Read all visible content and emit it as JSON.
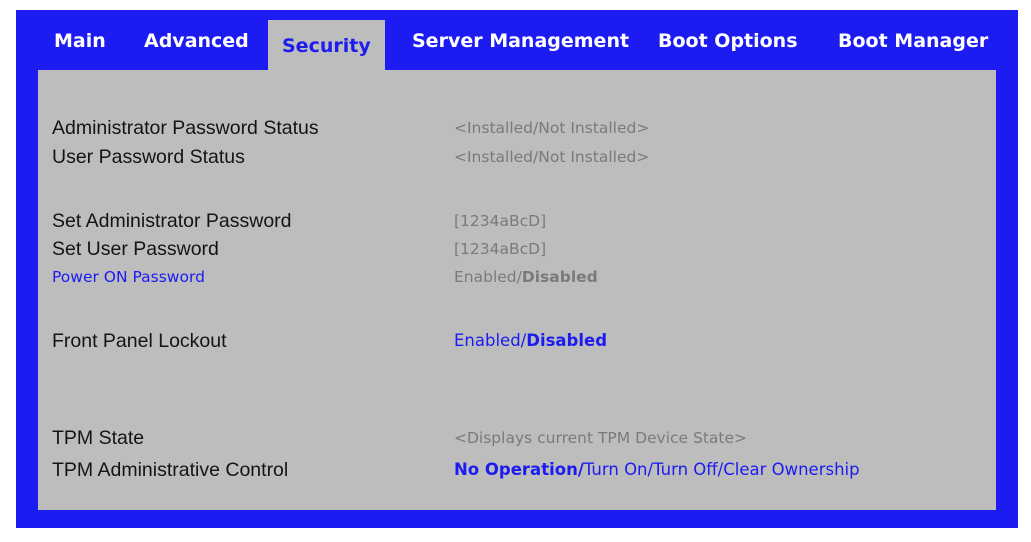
{
  "tabs": [
    {
      "label": "Main",
      "active": false
    },
    {
      "label": "Advanced",
      "active": false
    },
    {
      "label": "Security",
      "active": true
    },
    {
      "label": "Server Management",
      "active": false
    },
    {
      "label": "Boot Options",
      "active": false
    },
    {
      "label": "Boot Manager",
      "active": false
    }
  ],
  "rows": {
    "admin_status": {
      "label": "Administrator Password Status",
      "value": "<Installed/Not Installed>"
    },
    "user_status": {
      "label": "User Password Status",
      "value": "<Installed/Not Installed>"
    },
    "set_admin": {
      "label": "Set Administrator Password",
      "value": "[1234aBcD]"
    },
    "set_user": {
      "label": "Set User Password",
      "value": "[1234aBcD]"
    },
    "power_on": {
      "label": "Power ON Password",
      "value_normal": "Enabled/",
      "value_bold": "Disabled"
    },
    "front_panel": {
      "label": "Front Panel Lockout",
      "value_normal": "Enabled/",
      "value_bold": "Disabled"
    },
    "tpm_state": {
      "label": "TPM State",
      "value": "<Displays current TPM Device State>"
    },
    "tpm_admin": {
      "label": "TPM Administrative Control",
      "value_bold": "No Operation/",
      "value_normal": "Turn On/Turn Off/Clear Ownership"
    }
  },
  "colors": {
    "frame": "#1b1bf2",
    "panel": "#bdbdbd",
    "text_dark": "#141414",
    "text_gray": "#7a7a7a",
    "accent_blue": "#1b1bf2"
  }
}
